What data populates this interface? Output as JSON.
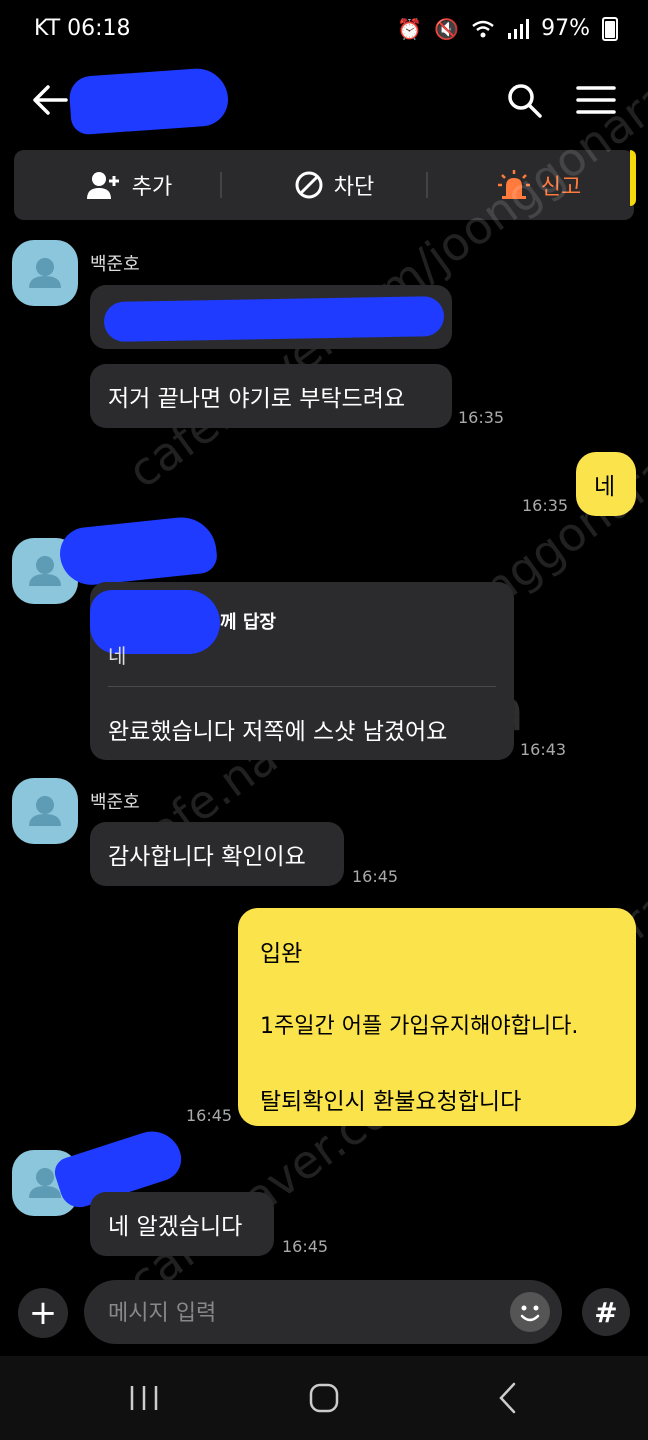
{
  "status": {
    "carrier_time": "KT 06:18",
    "battery": "97%"
  },
  "header": {
    "title": ""
  },
  "actions": {
    "add": "추가",
    "block": "차단",
    "report": "신고"
  },
  "messages": {
    "m1": {
      "sender": "백준호",
      "text": "저거 끝나면 야기로 부탁드려요",
      "time": "16:35"
    },
    "m2": {
      "text": "네",
      "time": "16:35"
    },
    "m3": {
      "reply_header": "께 답장",
      "reply_quote": "네",
      "text": "완료했습니다 저쪽에 스샷 남겼어요",
      "time": "16:43"
    },
    "m4": {
      "sender": "백준호",
      "text": "감사합니다 확인이요",
      "time": "16:45"
    },
    "m5": {
      "line1": "입완",
      "line2": "1주일간 어플 가입유지해야합니다.",
      "line3": "탈퇴확인시 환불요청합니다",
      "time": "16:45"
    },
    "m6": {
      "text": "네 알겠습니다",
      "time": "16:45"
    }
  },
  "input": {
    "placeholder": "메시지 입력"
  },
  "watermark": {
    "site": "cafe.naver.com/joonggonara",
    "logo": "joonggonara"
  },
  "colors": {
    "my_bubble": "#fbe44b",
    "their_bubble": "#2b2b2d",
    "report_accent": "#ff7a3d",
    "avatar": "#8cc6dc",
    "redaction": "#1f3bff"
  }
}
